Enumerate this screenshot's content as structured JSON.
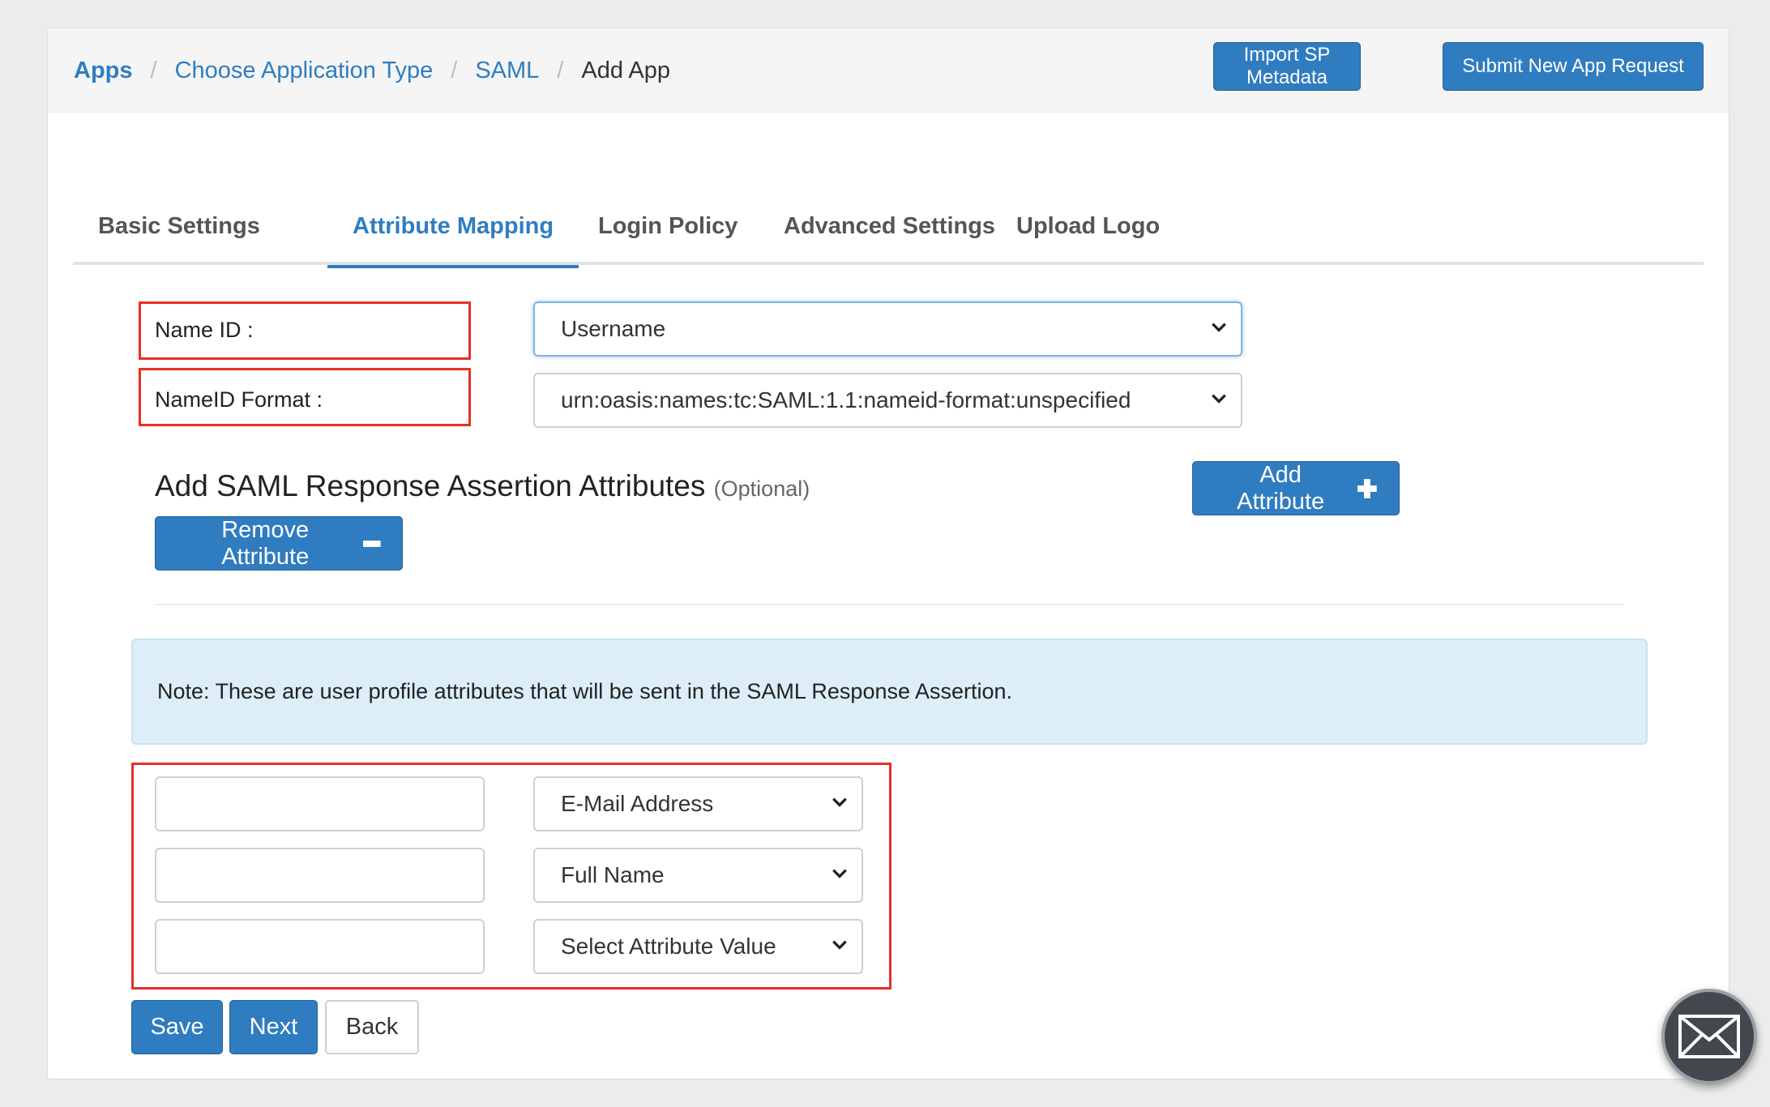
{
  "breadcrumb": {
    "items": [
      "Apps",
      "Choose Application Type",
      "SAML",
      "Add App"
    ],
    "separator": "/"
  },
  "header_buttons": {
    "import": "Import SP Metadata",
    "submit": "Submit New App Request"
  },
  "tabs": [
    {
      "label": "Basic Settings",
      "active": false
    },
    {
      "label": "Attribute Mapping",
      "active": true
    },
    {
      "label": "Login Policy",
      "active": false
    },
    {
      "label": "Advanced Settings",
      "active": false
    },
    {
      "label": "Upload Logo",
      "active": false
    }
  ],
  "form": {
    "name_id_label": "Name ID :",
    "name_id_value": "Username",
    "nameid_format_label": "NameID Format :",
    "nameid_format_value": "urn:oasis:names:tc:SAML:1.1:nameid-format:unspecified"
  },
  "attributes_section": {
    "title": "Add SAML Response Assertion Attributes",
    "optional": "(Optional)",
    "add_button": "Add Attribute",
    "remove_button": "Remove Attribute",
    "note": "Note: These are user profile attributes that will be sent in the SAML Response Assertion.",
    "rows": [
      {
        "name": "",
        "value": "E-Mail Address"
      },
      {
        "name": "",
        "value": "Full Name"
      },
      {
        "name": "",
        "value": "Select Attribute Value"
      }
    ]
  },
  "actions": {
    "save": "Save",
    "next": "Next",
    "back": "Back"
  },
  "colors": {
    "primary": "#2f7cc0",
    "link": "#2f7dc1",
    "highlight": "#e43224",
    "note_bg": "#ddeef8"
  },
  "icons": {
    "chevron": "chevron-down-icon",
    "plus": "plus-icon",
    "minus": "minus-icon",
    "chat": "envelope-icon"
  }
}
